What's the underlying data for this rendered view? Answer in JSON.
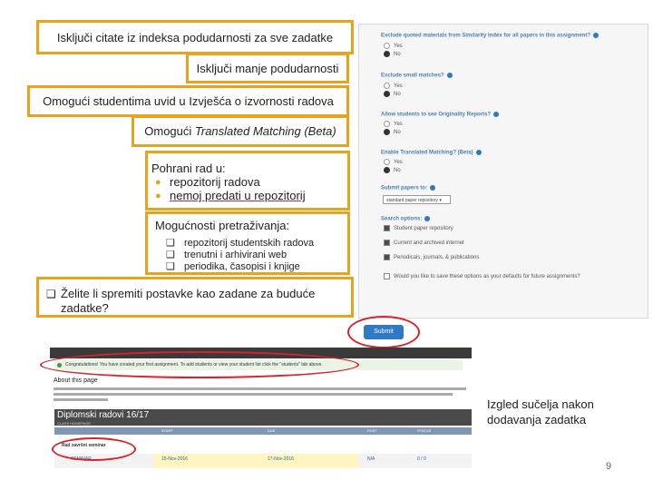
{
  "callouts": {
    "exclude_quotes": "Isključi citate iz indeksa podudarnosti za sve zadatke",
    "exclude_small": "Isključi manje podudarnosti",
    "allow_view": "Omogući studentima uvid u Izvješća o izvornosti radova",
    "translated_prefix": "Omogući ",
    "translated_italic": "Translated Matching (Beta)",
    "store_title": "Pohrani rad u:",
    "store_items": [
      "repozitorij radova",
      "nemoj predati u repozitorij"
    ],
    "search_title": "Mogućnosti pretraživanja:",
    "search_items": [
      "repozitorij studentskih radova",
      "trenutni i arhivirani web",
      "periodika, časopisi i knjige"
    ],
    "save_defaults": "Želite li spremiti postavke kao zadane za buduće zadatke?"
  },
  "panel": {
    "q1": "Exclude quoted materials from Similarity Index for all papers in this assignment?",
    "q2": "Exclude small matches?",
    "q3": "Allow students to see Originality Reports?",
    "q4": "Enable Translated Matching? (Beta)",
    "q5": "Submit papers to:",
    "q6": "Search options:",
    "yes": "Yes",
    "no": "No",
    "repo_select": "standard paper repository",
    "search_opt1": "Student paper repository",
    "search_opt2": "Current and archived internet",
    "search_opt3": "Periodicals, journals, & publications",
    "save_q": "Would you like to save these options as your defaults for future assignments?",
    "submit_label": "Submit"
  },
  "bottom": {
    "congrats": "Congratulations! You have created your first assignment. To add students or view your student list click the \"students\" tab above.",
    "about_title": "About this page",
    "class_title": "Diplomski radovi 16/17",
    "class_sub": "CLASS HOMEPAGE",
    "col_start": "START",
    "col_due": "DUE",
    "col_post": "POST",
    "col_status": "STATUS",
    "row_section": "Rad završni seminar",
    "row_name": "SEMINAR",
    "row_start": "15-Nov-2016",
    "row_due": "17-Nov-2016",
    "row_post": "N/A",
    "row_status": "0 / 0"
  },
  "side_note": [
    "Izgled sučelja nakon",
    "dodavanja zadatka"
  ],
  "page_number": "9"
}
